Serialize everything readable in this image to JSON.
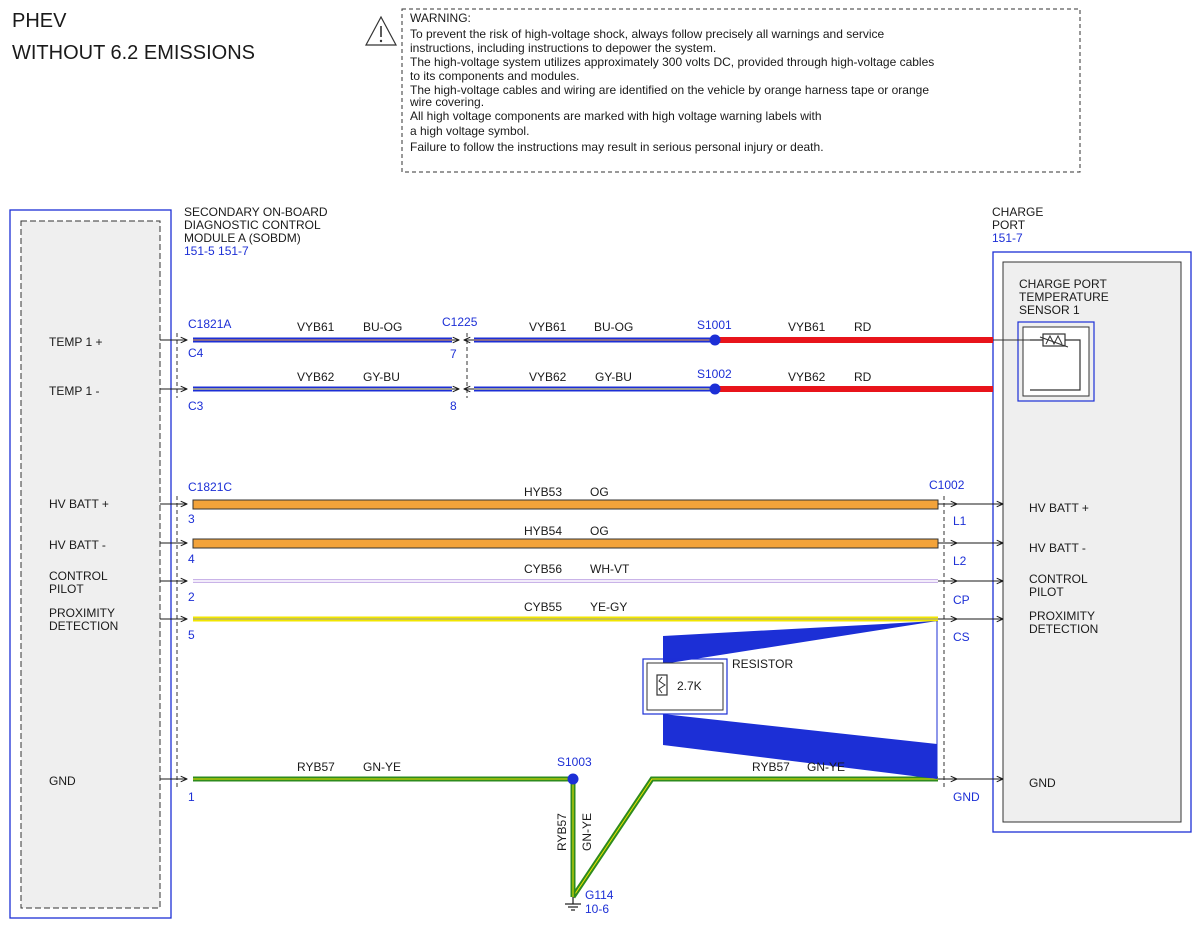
{
  "header": {
    "line1": "PHEV",
    "line2": "WITHOUT 6.2 EMISSIONS"
  },
  "warning": {
    "title": "WARNING:",
    "lines": [
      "To prevent the risk of high-voltage shock, always follow precisely all warnings and service",
      "instructions, including instructions to depower the system.",
      "The high-voltage system utilizes approximately 300 volts DC, provided through high-voltage cables",
      "to its components and modules.",
      "The high-voltage cables and wiring are identified on the vehicle by orange harness tape or orange",
      "wire covering.",
      "All high voltage components are marked with high voltage warning labels with",
      "a high voltage symbol.",
      "Failure to follow the instructions may result in serious personal injury or death."
    ]
  },
  "sobdm": {
    "title": [
      "SECONDARY ON-BOARD",
      "DIAGNOSTIC CONTROL",
      "MODULE A (SOBDM)"
    ],
    "refs": "151-5  151-7",
    "pins": {
      "temp_plus": "TEMP 1 +",
      "temp_minus": "TEMP 1 -",
      "hv_plus": "HV BATT +",
      "hv_minus": "HV BATT -",
      "control_pilot": [
        "CONTROL",
        "PILOT"
      ],
      "proximity": [
        "PROXIMITY",
        "DETECTION"
      ],
      "gnd": "GND"
    }
  },
  "charge_port": {
    "title": [
      "CHARGE",
      "PORT"
    ],
    "ref": "151-7",
    "sensor": [
      "CHARGE PORT",
      "TEMPERATURE",
      "SENSOR 1"
    ],
    "pins": {
      "hv_plus": "HV BATT +",
      "hv_minus": "HV BATT -",
      "control_pilot": [
        "CONTROL",
        "PILOT"
      ],
      "proximity": [
        "PROXIMITY",
        "DETECTION"
      ],
      "gnd": "GND"
    }
  },
  "connectors": {
    "c1821a": {
      "name": "C1821A",
      "pin_temp_plus": "C4",
      "pin_temp_minus": "C3"
    },
    "c1225": {
      "name": "C1225",
      "pin_temp_plus": "7",
      "pin_temp_minus": "8"
    },
    "c1821c": {
      "name": "C1821C",
      "pins": [
        "3",
        "4",
        "2",
        "5",
        "1"
      ]
    },
    "c1002": {
      "name": "C1002",
      "pins": [
        "L1",
        "L2",
        "CP",
        "CS",
        "GND"
      ]
    }
  },
  "splices": {
    "s1001": "S1001",
    "s1002": "S1002",
    "s1003": "S1003"
  },
  "circuits": {
    "temp1_a": {
      "circuit": "VYB61",
      "color": "BU-OG"
    },
    "temp1_b": {
      "circuit": "VYB61",
      "color": "BU-OG"
    },
    "temp1_c": {
      "circuit": "VYB61",
      "color": "RD"
    },
    "temp2_a": {
      "circuit": "VYB62",
      "color": "GY-BU"
    },
    "temp2_b": {
      "circuit": "VYB62",
      "color": "GY-BU"
    },
    "temp2_c": {
      "circuit": "VYB62",
      "color": "RD"
    },
    "hv_plus": {
      "circuit": "HYB53",
      "color": "OG"
    },
    "hv_minus": {
      "circuit": "HYB54",
      "color": "OG"
    },
    "cp": {
      "circuit": "CYB56",
      "color": "WH-VT"
    },
    "prox": {
      "circuit": "CYB55",
      "color": "YE-GY"
    },
    "gnd_left": {
      "circuit": "RYB57",
      "color": "GN-YE"
    },
    "gnd_right": {
      "circuit": "RYB57",
      "color": "GN-YE"
    },
    "gnd_drop": {
      "circuit": "RYB57",
      "color": "GN-YE"
    }
  },
  "resistor": {
    "label": "RESISTOR",
    "value": "2.7K"
  },
  "ground": {
    "name": "G114",
    "ref": "10-6"
  },
  "icons": {
    "warning": "warning-triangle-icon",
    "sensor": "thermistor-icon",
    "resistor": "resistor-icon",
    "ground": "ground-symbol-icon"
  },
  "colors": {
    "blue": "#1c2fd6",
    "red": "#e8141b",
    "orange": "#f3a33a",
    "yellow": "#f2e600",
    "green": "#2e8b1e",
    "gray": "#9a9a9a"
  }
}
